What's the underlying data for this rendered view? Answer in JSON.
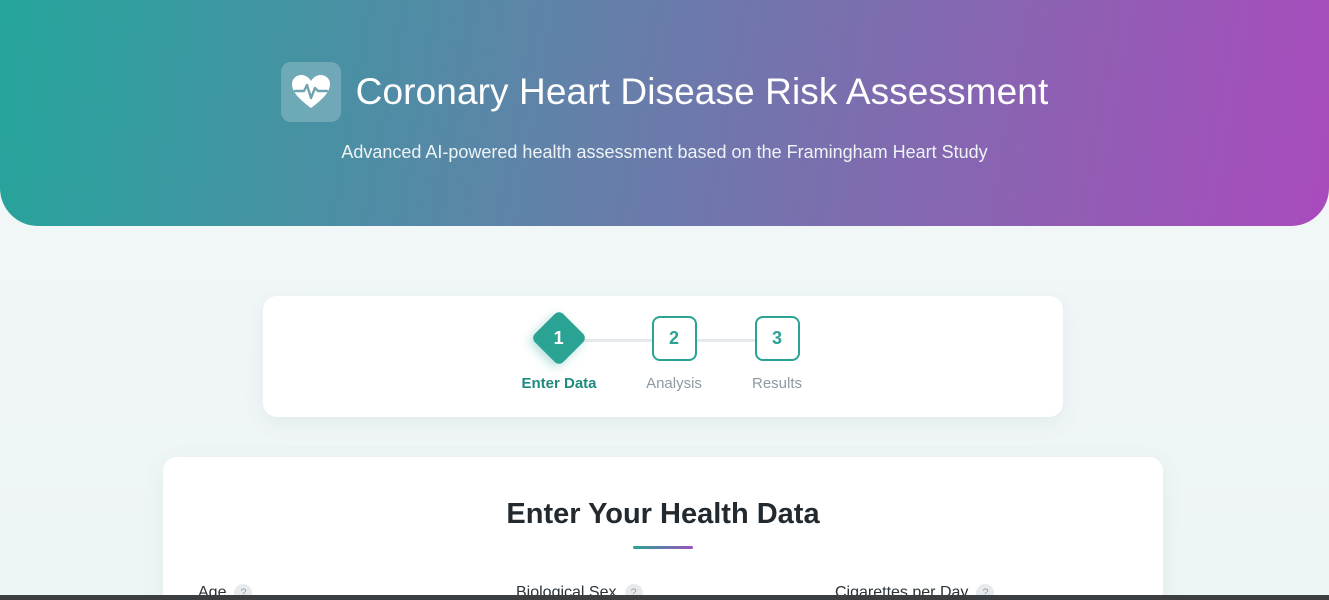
{
  "header": {
    "logo_icon": "heartbeat-icon",
    "title": "Coronary Heart Disease Risk Assessment",
    "subtitle": "Advanced AI-powered health assessment based on the Framingham Heart Study"
  },
  "stepper": {
    "steps": [
      {
        "number": "1",
        "label": "Enter Data",
        "state": "active"
      },
      {
        "number": "2",
        "label": "Analysis",
        "state": "pending"
      },
      {
        "number": "3",
        "label": "Results",
        "state": "pending"
      }
    ]
  },
  "form": {
    "title": "Enter Your Health Data",
    "fields": [
      {
        "label": "Age",
        "help": "?"
      },
      {
        "label": "Biological Sex",
        "help": "?"
      },
      {
        "label": "Cigarettes per Day",
        "help": "?"
      }
    ]
  },
  "colors": {
    "accent": "#2aa394",
    "gradient_start": "#24a59b",
    "gradient_end": "#a94bbd"
  }
}
